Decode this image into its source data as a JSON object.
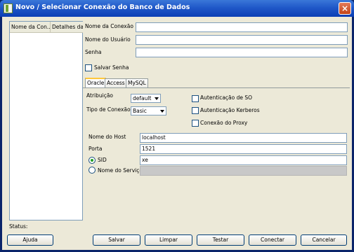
{
  "window": {
    "title": "Novo / Selecionar Conexão do Banco de Dados",
    "close_symbol": "×"
  },
  "left_list": {
    "columns": [
      "Nome da Con...",
      "Detalhes da"
    ]
  },
  "connection": {
    "name_label": "Nome da Conexão",
    "name_value": "",
    "user_label": "Nome do Usuário",
    "user_value": "",
    "password_label": "Senha",
    "password_value": "",
    "save_password_label": "Salvar Senha"
  },
  "tabs": [
    "Oracle",
    "Access",
    "MySQL"
  ],
  "oracle": {
    "role_label": "Atribuição",
    "role_value": "default",
    "conn_type_label": "Tipo de Conexão",
    "conn_type_value": "Basic",
    "os_auth_label": "Autenticação de SO",
    "kerberos_label": "Autenticação Kerberos",
    "proxy_label": "Conexão do Proxy",
    "host_label": "Nome do Host",
    "host_value": "localhost",
    "port_label": "Porta",
    "port_value": "1521",
    "sid_label": "SID",
    "sid_value": "xe",
    "service_label": "Nome do Serviço",
    "service_value": ""
  },
  "status": {
    "label": "Status:"
  },
  "buttons": {
    "help": "Ajuda",
    "save": "Salvar",
    "clear": "Limpar",
    "test": "Testar",
    "connect": "Conectar",
    "cancel": "Cancelar"
  }
}
